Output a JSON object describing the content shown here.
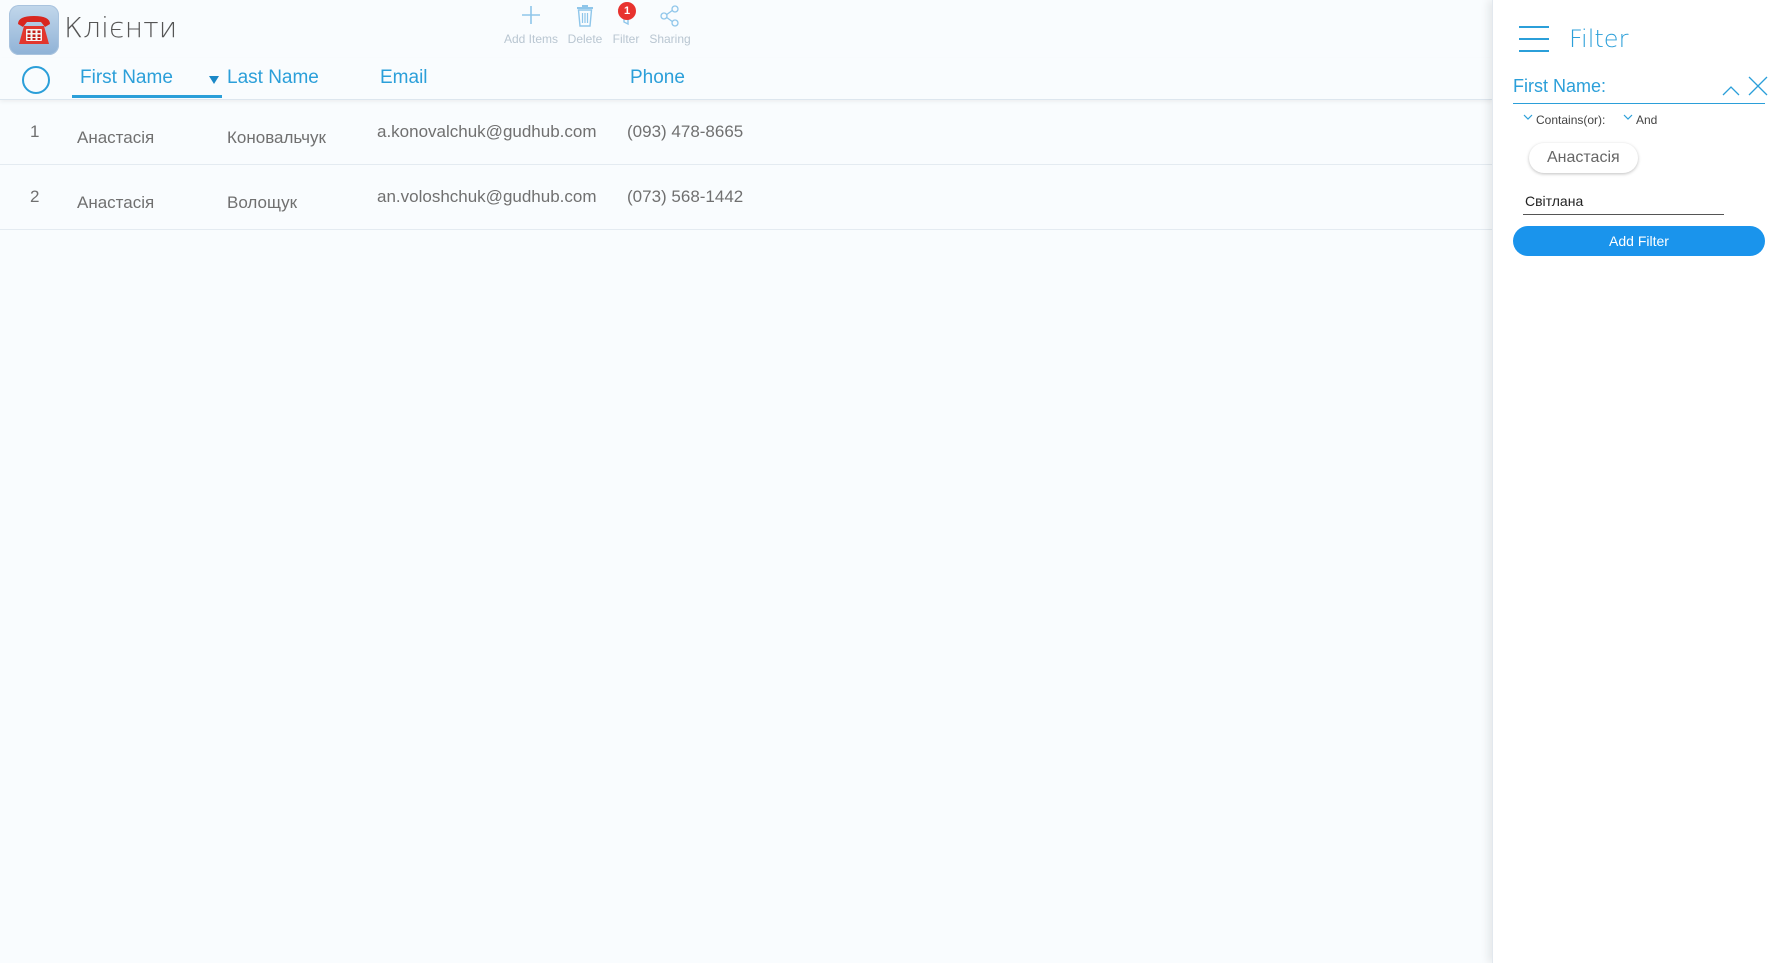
{
  "app": {
    "title": "Клієнти",
    "icon": "red-telephone-icon"
  },
  "toolbar": {
    "add_label": "Add Items",
    "delete_label": "Delete",
    "filter_label": "Filter",
    "filter_badge": "1",
    "sharing_label": "Sharing"
  },
  "table": {
    "columns": {
      "first_name": "First Name",
      "last_name": "Last Name",
      "email": "Email",
      "phone": "Phone"
    },
    "sorted_by": "first_name",
    "rows": [
      {
        "num": "1",
        "first_name": "Анастасія",
        "last_name": "Коновальчук",
        "email": "a.konovalchuk@gudhub.com",
        "phone": "(093) 478-8665"
      },
      {
        "num": "2",
        "first_name": "Анастасія",
        "last_name": "Волощук",
        "email": "an.voloshchuk@gudhub.com",
        "phone": "(073) 568-1442"
      }
    ]
  },
  "filter_panel": {
    "title": "Filter",
    "field_label": "First Name:",
    "condition": "Contains(or):",
    "logic": "And",
    "chip": "Анастасія",
    "input_value": "Світлана",
    "add_button": "Add Filter"
  },
  "colors": {
    "accent": "#2b9fd9",
    "button": "#1a94ec",
    "badge": "#e8322e",
    "background": "#f9fcfe"
  }
}
